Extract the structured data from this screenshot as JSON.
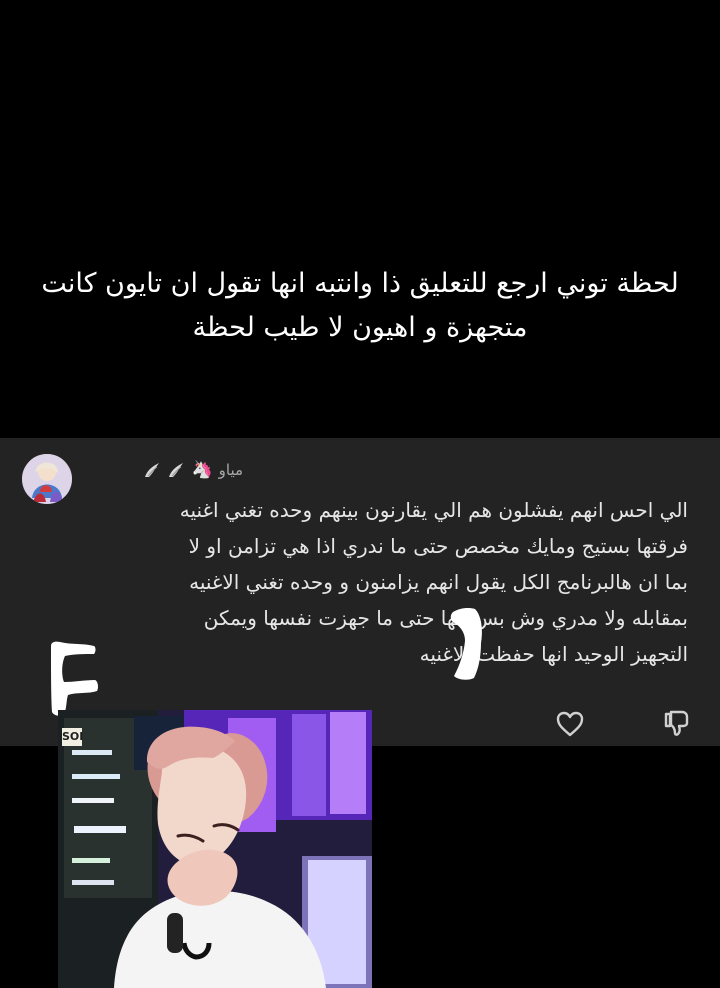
{
  "caption": {
    "text": "لحظة توني ارجع للتعليق ذا وانتبه انها تقول ان تايون كانت متجهزة و اهيون لا طيب لحظة"
  },
  "comment": {
    "username": "مياو",
    "username_emoji": "🦄",
    "badges": [
      "wing-icon",
      "wing-icon"
    ],
    "lines": [
      "الي احس انهم يفشلون هم الي يقارنون بينهم وحده تغني اغنيه",
      "فرقتها بستيج ومايك مخصص حتى ما ندري اذا هي تزامن او لا",
      "بما ان هالبرنامج الكل يقول انهم يزامنون و وحده تغني الاغنيه",
      "بمقابله ولا مدري وش بس انها حتى ما جهزت نفسها ويمكن",
      "التجهيز الوحيد انها حفظت الاغنيه"
    ]
  },
  "actions": {
    "like_icon": "heart-icon",
    "dislike_icon": "thumbs-down-icon"
  },
  "photo": {
    "corner_label": "SOI"
  },
  "colors": {
    "background": "#000000",
    "card": "#232323",
    "text": "#e6e6e6",
    "username": "#a6a6a6"
  }
}
